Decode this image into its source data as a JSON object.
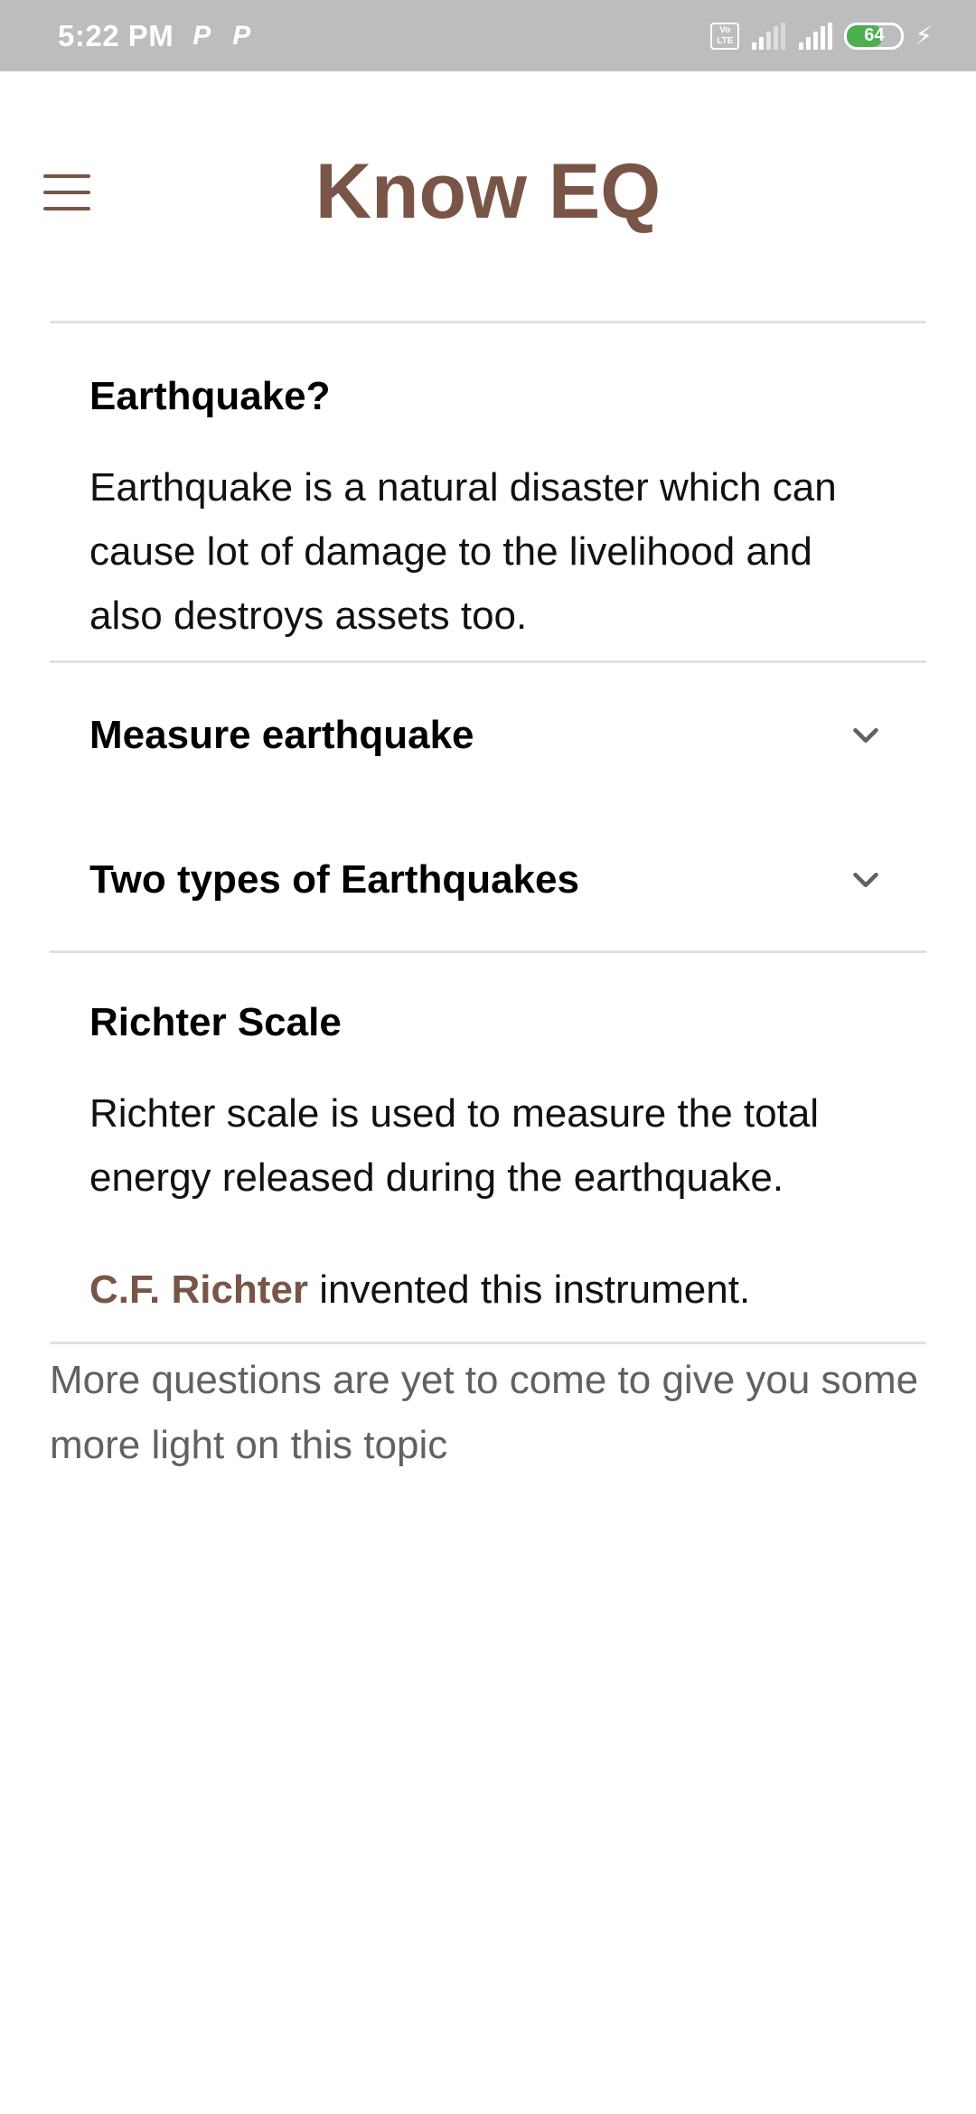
{
  "status_bar": {
    "time": "5:22 PM",
    "notif_icons": [
      "P",
      "P"
    ],
    "volte_top": "Vo",
    "volte_bottom": "LTE",
    "battery": "64",
    "battery_level": 0.64,
    "colors": {
      "background": "#bdbdbd",
      "battery_fill": "#4caf50"
    }
  },
  "header": {
    "title": "Know EQ",
    "menu_icon": "menu-icon",
    "accent_color": "#795548"
  },
  "sections": [
    {
      "title": "Earthquake?",
      "expanded": true,
      "body": "Earthquake is a natural disaster which can cause lot of damage to the livelihood and also destroys assets too."
    },
    {
      "title": "Measure earthquake",
      "expanded": false,
      "icon": "chevron-down-icon"
    },
    {
      "title": "Two types of Earthquakes",
      "expanded": false,
      "icon": "chevron-down-icon"
    },
    {
      "title": "Richter Scale",
      "expanded": true,
      "body": "Richter scale is used to measure the total energy released during the earthquake.",
      "note_highlight": "C.F. Richter",
      "note_rest": " invented this instrument."
    }
  ],
  "footer_note": "More questions are yet to come to give you some more light on this topic"
}
